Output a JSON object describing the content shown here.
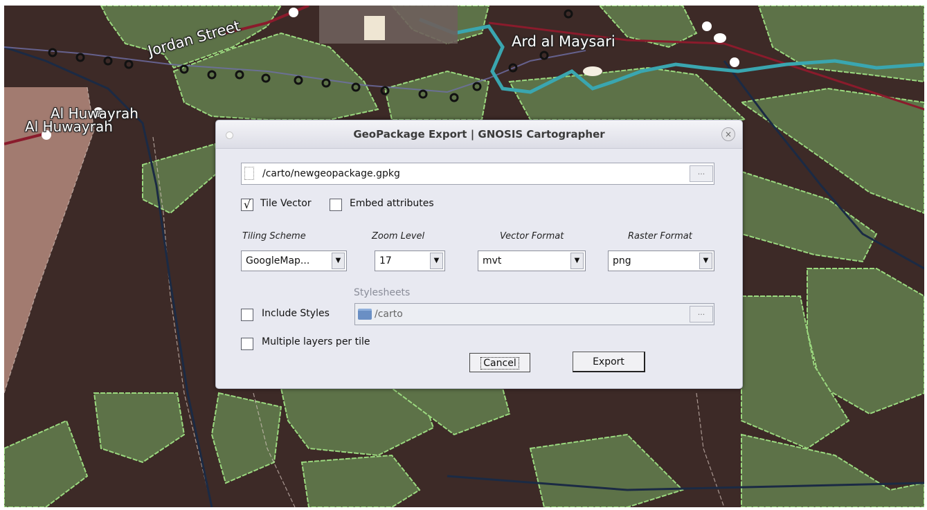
{
  "map": {
    "labels": {
      "jordan_street": "Jordan Street",
      "ard_al_maysari": "Ard al Maysari",
      "al_huwayrah_1": "Al Huwayrah",
      "al_huwayrah_2": "Al Huwayrah"
    }
  },
  "dialog": {
    "title": "GeoPackage Export | GNOSIS Cartographer",
    "close_glyph": "×",
    "output_path": "/carto/newgeopackage.gpkg",
    "browse_label": "...",
    "tile_vector": {
      "label": "Tile Vector",
      "checked": true,
      "mark": "√"
    },
    "embed_attributes": {
      "label": "Embed attributes",
      "checked": false
    },
    "tiling_scheme": {
      "label": "Tiling Scheme",
      "value": "GoogleMap..."
    },
    "zoom_level": {
      "label": "Zoom Level",
      "value": "17"
    },
    "vector_format": {
      "label": "Vector Format",
      "value": "mvt"
    },
    "raster_format": {
      "label": "Raster Format",
      "value": "png"
    },
    "dropdown_glyph": "▼",
    "include_styles": {
      "label": "Include Styles",
      "checked": false
    },
    "stylesheets": {
      "label": "Stylesheets",
      "path": "/carto"
    },
    "multiple_layers": {
      "label": "Multiple layers per tile",
      "checked": false
    },
    "cancel_label": "Cancel",
    "export_label": "Export"
  },
  "colors": {
    "map_background": "#3d2a27",
    "field_boundary": "#9bd97f",
    "river": "#3aa6b0",
    "dialog_background": "#e8e9f1"
  }
}
